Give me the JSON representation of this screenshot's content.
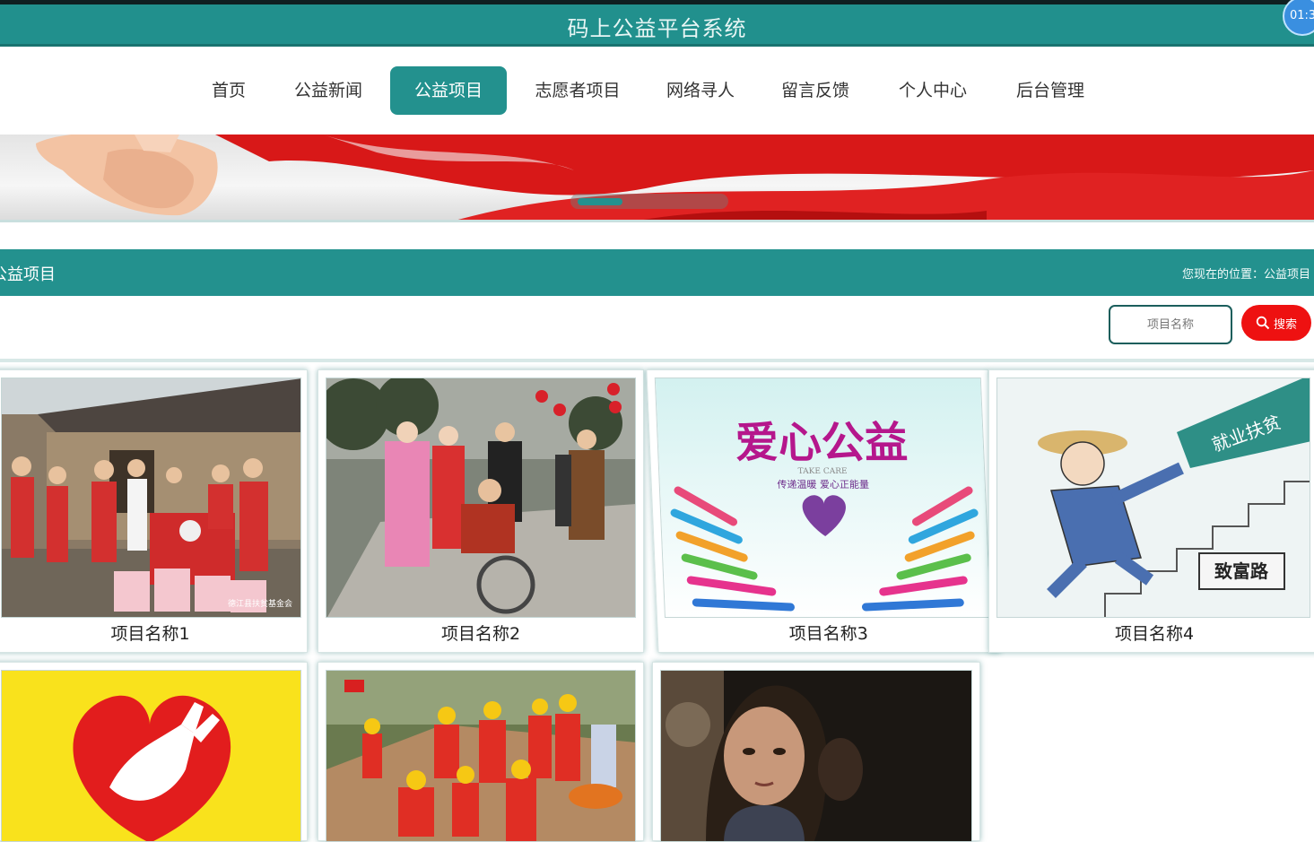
{
  "header": {
    "title": "码上公益平台系统",
    "timer": "01:3"
  },
  "nav": {
    "items": [
      "首页",
      "公益新闻",
      "公益项目",
      "志愿者项目",
      "网络寻人",
      "留言反馈",
      "个人中心",
      "后台管理"
    ],
    "active": "公益项目"
  },
  "section": {
    "title": "公益项目",
    "breadcrumb": "您现在的位置：公益项目"
  },
  "search": {
    "placeholder": "项目名称",
    "button_label": "搜索"
  },
  "projects": [
    {
      "name": "项目名称1",
      "photo_caption": "德江县扶贫基金会"
    },
    {
      "name": "项目名称2"
    },
    {
      "name": "项目名称3",
      "poster_title": "爱心公益",
      "poster_subtitle": "TAKE CARE",
      "poster_slogan": "传递温暖 爱心正能量"
    },
    {
      "name": "项目名称4",
      "cartoon_sign_1": "就业扶贫",
      "cartoon_sign_2": "致富路"
    },
    {
      "name": ""
    },
    {
      "name": ""
    },
    {
      "name": ""
    }
  ],
  "colors": {
    "primary": "#23918e",
    "search_button": "#ee1111",
    "top_strip": "#0f1f21"
  }
}
